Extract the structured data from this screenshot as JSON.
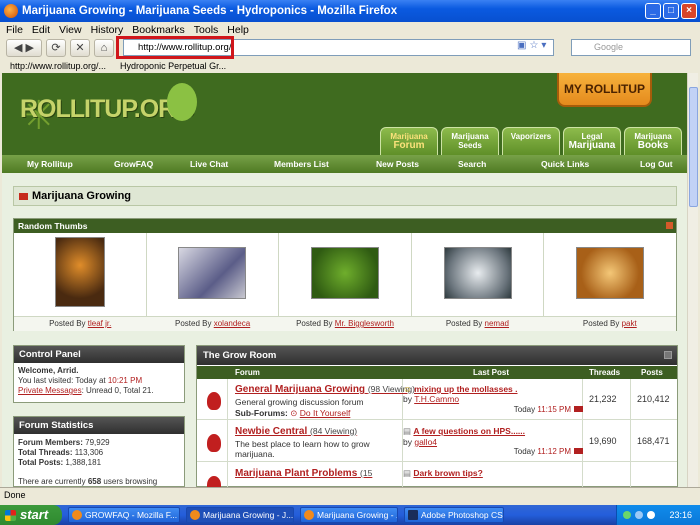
{
  "window": {
    "title": "Marijuana Growing - Marijuana Seeds - Hydroponics - Mozilla Firefox"
  },
  "menu": [
    "File",
    "Edit",
    "View",
    "History",
    "Bookmarks",
    "Tools",
    "Help"
  ],
  "address": {
    "url": "http://www.rollitup.org/"
  },
  "search": {
    "placeholder": "Google"
  },
  "bookmarks": [
    "http://www.rollitup.org/...",
    "Hydroponic Perpetual Gr..."
  ],
  "site": {
    "logo": "ROLLITUP.ORG",
    "my_rollitup": "MY ROLLITUP",
    "tabs": [
      {
        "l1": "Marijuana",
        "l2": "Forum"
      },
      {
        "l1": "Marijuana",
        "l2": "Seeds"
      },
      {
        "l1": "Vaporizers",
        "l2": ""
      },
      {
        "l1": "Legal",
        "l2": "Marijuana"
      },
      {
        "l1": "Marijuana",
        "l2": "Books"
      }
    ],
    "nav": [
      "My Rollitup",
      "GrowFAQ",
      "Live Chat",
      "Members List",
      "New Posts",
      "Search",
      "Quick Links",
      "Log Out"
    ]
  },
  "breadcrumb": "Marijuana Growing",
  "random_thumbs": {
    "title": "Random Thumbs",
    "posted_by_label": "Posted By",
    "posters": [
      "tleaf jr.",
      "xolandeca",
      "Mr. Bigglesworth",
      "nemad",
      "pakt"
    ]
  },
  "control_panel": {
    "title": "Control Panel",
    "welcome": "Welcome, Arrid.",
    "last_visited_label": "You last visited: Today at",
    "last_visited_time": "10:21 PM",
    "pm_link": "Private Messages",
    "pm_counts": ": Unread 0, Total 21."
  },
  "forum_stats": {
    "title": "Forum Statistics",
    "members_label": "Forum Members:",
    "members": "79,929",
    "threads_label": "Total Threads:",
    "threads": "113,306",
    "posts_label": "Total Posts:",
    "posts": "1,388,181",
    "browsing_pre": "There are currently",
    "browsing_count": "658",
    "browsing_post": "users browsing"
  },
  "grow_room": {
    "title": "The Grow Room",
    "cols": {
      "forum": "Forum",
      "last_post": "Last Post",
      "threads": "Threads",
      "posts": "Posts"
    },
    "forums": [
      {
        "name": "General Marijuana Growing",
        "viewing": "(98 Viewing)",
        "desc": "General growing discussion forum",
        "sub_label": "Sub-Forums:",
        "sub": "Do It Yourself",
        "last_title": "mixing up the mollasses .",
        "by": "T.H.Cammo",
        "time_pre": "Today",
        "time": "11:15 PM",
        "threads": "21,232",
        "posts": "210,412"
      },
      {
        "name": "Newbie Central",
        "viewing": "(84 Viewing)",
        "desc": "The best place to learn how to grow marijuana.",
        "last_title": "A few questions on HPS......",
        "by": "gallo4",
        "time_pre": "Today",
        "time": "11:12 PM",
        "threads": "19,690",
        "posts": "168,471"
      },
      {
        "name": "Marijuana Plant Problems",
        "viewing": "(15",
        "last_title": "Dark brown tips?"
      }
    ]
  },
  "status": "Done",
  "taskbar": {
    "start": "start",
    "tasks": [
      "GROWFAQ - Mozilla F...",
      "Marijuana Growing - J...",
      "Marijuana Growing - ...",
      "Adobe Photoshop CS3"
    ],
    "clock": "23:16"
  }
}
